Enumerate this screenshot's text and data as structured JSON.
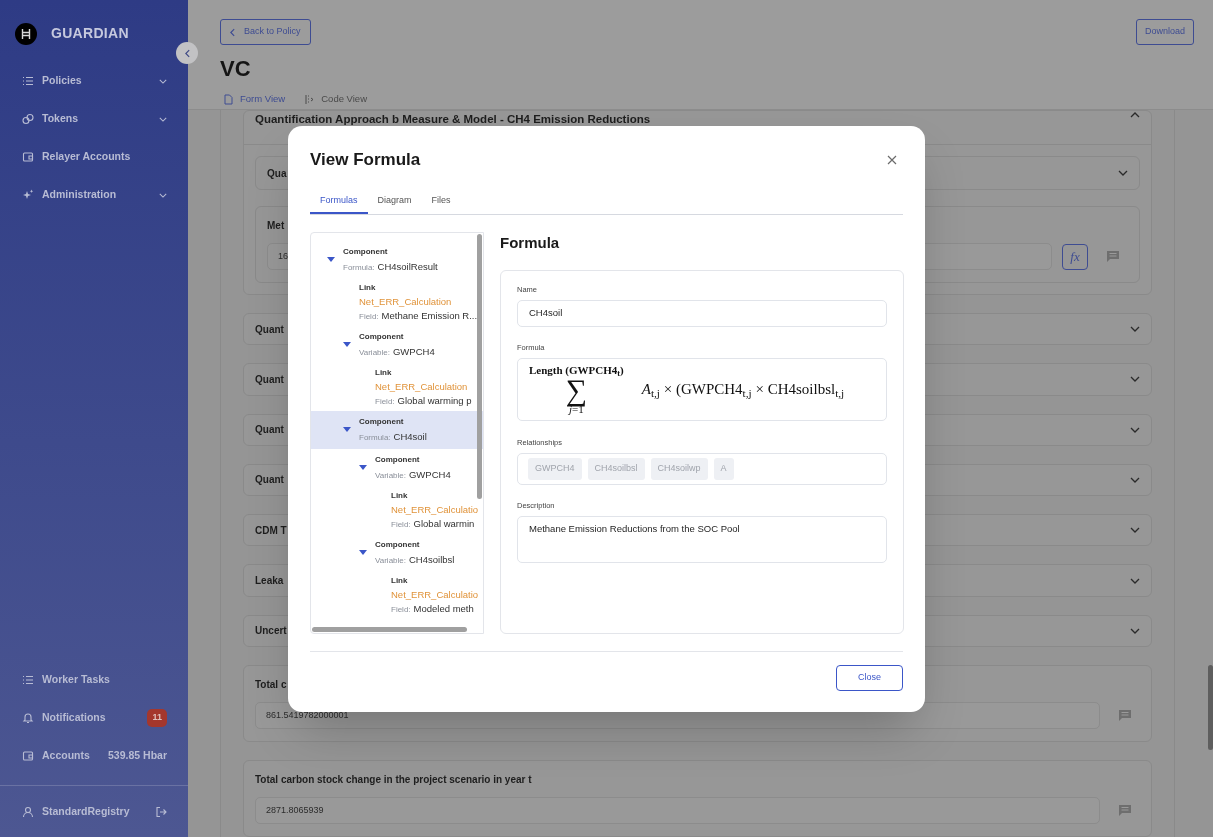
{
  "sidebar": {
    "brand": "GUARDIAN",
    "nav": [
      {
        "label": "Policies",
        "has_submenu": true
      },
      {
        "label": "Tokens",
        "has_submenu": true
      },
      {
        "label": "Relayer Accounts",
        "has_submenu": false
      },
      {
        "label": "Administration",
        "has_submenu": true
      }
    ],
    "footer_items": [
      {
        "label": "Worker Tasks"
      },
      {
        "label": "Notifications",
        "badge": "11"
      },
      {
        "label": "Accounts",
        "value": "539.85 Hbar"
      }
    ],
    "user": "StandardRegistry"
  },
  "header": {
    "back_button": "Back to Policy",
    "download_button": "Download",
    "title": "VC",
    "view_tabs": [
      {
        "label": "Form View",
        "selected": true
      },
      {
        "label": "Code View",
        "selected": false
      }
    ]
  },
  "sections": [
    {
      "kind": "group",
      "title": "Quantification Approach b Measure & Model - CH4 Emission Reductions",
      "expanded": true,
      "children": [
        {
          "kind": "collapsed",
          "title": "Qua"
        },
        {
          "kind": "field",
          "label": "Met",
          "value": "16",
          "formula_button": "fx"
        }
      ]
    },
    {
      "kind": "collapsed",
      "title": "Quant"
    },
    {
      "kind": "collapsed",
      "title": "Quant"
    },
    {
      "kind": "collapsed",
      "title": "Quant"
    },
    {
      "kind": "collapsed",
      "title": "Quant"
    },
    {
      "kind": "collapsed",
      "title": "CDM T"
    },
    {
      "kind": "collapsed",
      "title": "Leaka"
    },
    {
      "kind": "collapsed",
      "title": "Uncert"
    },
    {
      "kind": "field",
      "label": "Total c",
      "value": "861.5419782000001"
    },
    {
      "kind": "field",
      "label": "Total carbon stock change in the project scenario in year t",
      "value": "2871.8065939"
    }
  ],
  "modal": {
    "title": "View Formula",
    "tabs": [
      {
        "label": "Formulas",
        "selected": true
      },
      {
        "label": "Diagram",
        "selected": false
      },
      {
        "label": "Files",
        "selected": false
      }
    ],
    "tree": [
      {
        "kind": "component",
        "label": "Component",
        "ref_label": "Formula:",
        "ref": "CH4soilResult",
        "expanded": true,
        "selected": false,
        "children": [
          {
            "kind": "link",
            "label": "Link",
            "name": "Net_ERR_Calculation",
            "field_label": "Field:",
            "field": "Methane Emission R...",
            "selected": false
          },
          {
            "kind": "component",
            "label": "Component",
            "ref_label": "Variable:",
            "ref": "GWPCH4",
            "expanded": true,
            "selected": false,
            "children": [
              {
                "kind": "link",
                "label": "Link",
                "name": "Net_ERR_Calculation",
                "field_label": "Field:",
                "field": "Global warming p",
                "selected": false
              }
            ]
          },
          {
            "kind": "component",
            "label": "Component",
            "ref_label": "Formula:",
            "ref": "CH4soil",
            "expanded": true,
            "selected": true,
            "children": [
              {
                "kind": "component",
                "label": "Component",
                "ref_label": "Variable:",
                "ref": "GWPCH4",
                "expanded": true,
                "selected": false,
                "children": [
                  {
                    "kind": "link",
                    "label": "Link",
                    "name": "Net_ERR_Calculatio",
                    "field_label": "Field:",
                    "field": "Global warmin",
                    "selected": false
                  }
                ]
              },
              {
                "kind": "component",
                "label": "Component",
                "ref_label": "Variable:",
                "ref": "CH4soilbsl",
                "expanded": true,
                "selected": false,
                "children": [
                  {
                    "kind": "link",
                    "label": "Link",
                    "name": "Net_ERR_Calculatio",
                    "field_label": "Field:",
                    "field": "Modeled meth",
                    "selected": false
                  }
                ]
              }
            ]
          }
        ]
      }
    ],
    "detail": {
      "heading": "Formula",
      "name_label": "Name",
      "name": "CH4soil",
      "formula_label": "Formula",
      "formula": {
        "upper_limit": "Length (GWPCH4$_{t}$)",
        "operator": "∑",
        "lower_limit": "*j*=1",
        "body": "*A*$_{t,j}$ × (GWPCH4$_{t,j}$ × CH4soilbsl$_{t,j}$"
      },
      "relationships_label": "Relationships",
      "relationships": [
        "GWPCH4",
        "CH4soilbsl",
        "CH4soilwp",
        "A"
      ],
      "description_label": "Description",
      "description": "Methane Emission Reductions from the SOC Pool"
    },
    "close_button": "Close"
  }
}
